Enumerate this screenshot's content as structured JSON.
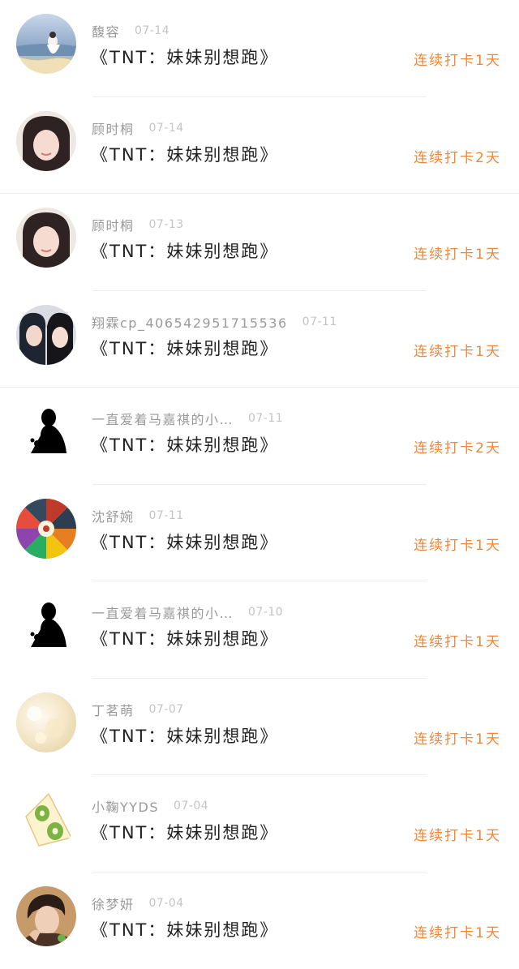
{
  "entries": [
    {
      "username": "馥容",
      "date": "07-14",
      "title": "《TNT：妹妹别想跑》",
      "streak": "连续打卡1天",
      "avatar_icon": "sea-portrait-avatar",
      "avatar_color": "#8fa8c8"
    },
    {
      "username": "顾时桐",
      "date": "07-14",
      "title": "《TNT：妹妹别想跑》",
      "streak": "连续打卡2天",
      "avatar_icon": "girl-selfie-avatar",
      "avatar_color": "#3a2a2a"
    },
    {
      "username": "顾时桐",
      "date": "07-13",
      "title": "《TNT：妹妹别想跑》",
      "streak": "连续打卡1天",
      "avatar_icon": "girl-selfie-avatar",
      "avatar_color": "#3a2a2a"
    },
    {
      "username": "翔霖cp_406542951715536",
      "date": "07-11",
      "title": "《TNT：妹妹别想跑》",
      "streak": "连续打卡1天",
      "avatar_icon": "couple-photo-avatar",
      "avatar_color": "#1e2430"
    },
    {
      "username": "一直爱着马嘉祺的小…",
      "date": "07-11",
      "title": "《TNT：妹妹别想跑》",
      "streak": "连续打卡2天",
      "avatar_icon": "silhouette-avatar",
      "avatar_color": "#000000"
    },
    {
      "username": "沈舒婉",
      "date": "07-11",
      "title": "《TNT：妹妹别想跑》",
      "streak": "连续打卡1天",
      "avatar_icon": "colorful-wheel-avatar",
      "avatar_color": "#c0392b"
    },
    {
      "username": "一直爱着马嘉祺的小…",
      "date": "07-10",
      "title": "《TNT：妹妹别想跑》",
      "streak": "连续打卡1天",
      "avatar_icon": "silhouette-avatar",
      "avatar_color": "#000000"
    },
    {
      "username": "丁茗萌",
      "date": "07-07",
      "title": "《TNT：妹妹别想跑》",
      "streak": "连续打卡1天",
      "avatar_icon": "bokeh-avatar",
      "avatar_color": "#f3e6c8"
    },
    {
      "username": "小鞠YYDS",
      "date": "07-04",
      "title": "《TNT：妹妹别想跑》",
      "streak": "连续打卡1天",
      "avatar_icon": "kiwi-sandwich-avatar",
      "avatar_color": "#7cb342"
    },
    {
      "username": "徐梦妍",
      "date": "07-04",
      "title": "《TNT：妹妹别想跑》",
      "streak": "连续打卡1天",
      "avatar_icon": "boy-portrait-avatar",
      "avatar_color": "#5a3a2a"
    }
  ],
  "colors": {
    "streak": "#f0873a",
    "username": "#9a9a9a",
    "date": "#c4c4c4",
    "title": "#222222"
  }
}
